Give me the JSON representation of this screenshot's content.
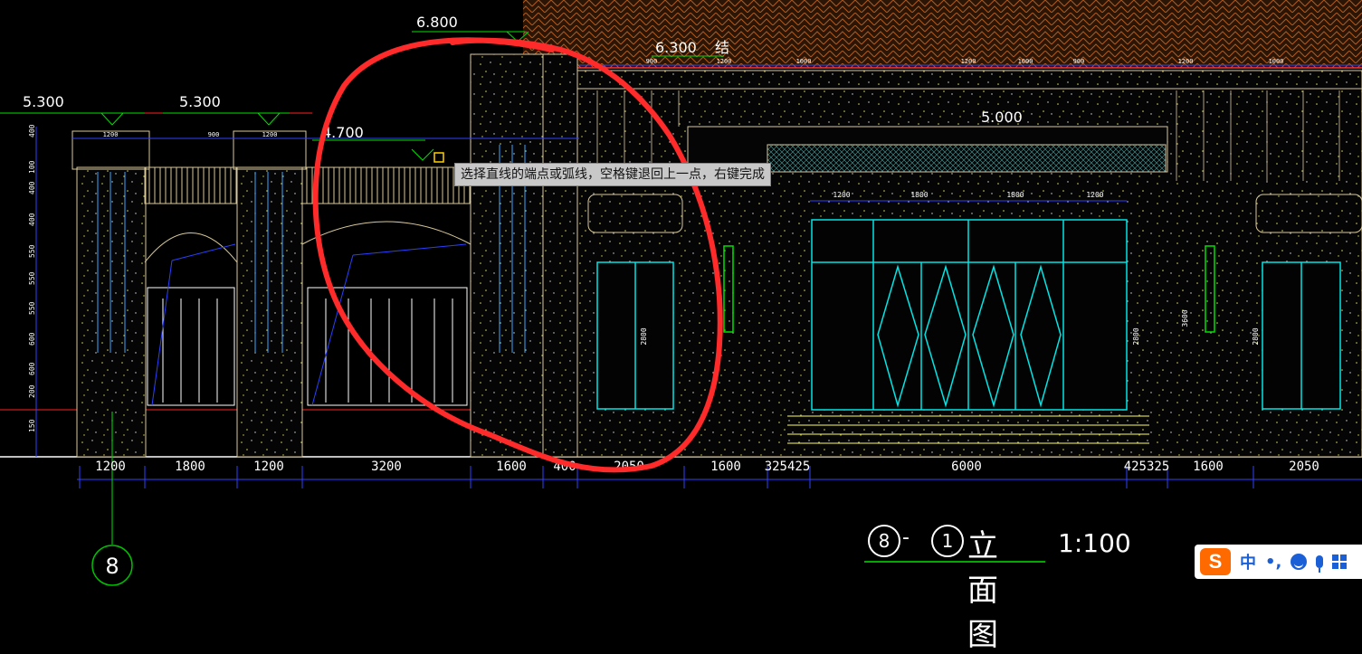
{
  "elevation_labels": [
    "6.800",
    "6.300",
    "结",
    "5.300",
    "5.300",
    "4.700",
    "5.000"
  ],
  "bottom_dimensions": [
    "1200",
    "1800",
    "1200",
    "3200",
    "1600",
    "400",
    "2050",
    "1600",
    "325425",
    "6000",
    "425325",
    "1600",
    "2050"
  ],
  "left_dimensions": [
    "400",
    "100",
    "400",
    "400",
    "550",
    "550",
    "550",
    "600",
    "600",
    "200",
    "150"
  ],
  "top_dimensions": [
    "1200",
    "900",
    "1200",
    "900",
    "1200",
    "1000",
    "1200",
    "1000",
    "900",
    "1200",
    "1000"
  ],
  "door_dimensions": [
    "1200",
    "1800",
    "1800",
    "1200",
    "2800",
    "2800",
    "3600",
    "2800"
  ],
  "axis_label": "8",
  "tooltip": "选择直线的端点或弧线，空格键退回上一点，右键完成",
  "title": {
    "num_a": "8",
    "dash": "-",
    "num_b": "1",
    "text": "立面图",
    "scale": "1:100"
  },
  "ime": {
    "logo": "S",
    "lang": "中",
    "punct": "•,"
  },
  "colors": {
    "background": "#000000",
    "wall_line": "#d8c89a",
    "dimension": "#3040ff",
    "door": "#00e5e5",
    "annotation": "#ff2a2a",
    "grid_axis": "#00c000",
    "roof": "#b05a20"
  }
}
